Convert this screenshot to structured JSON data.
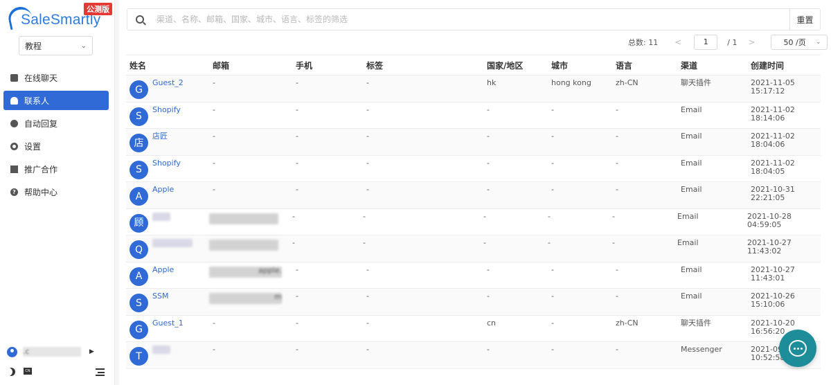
{
  "brand": {
    "name": "SaleSmartly",
    "badge": "公测版",
    "accent": "#2f6ad6"
  },
  "workspace": {
    "selected": "教程"
  },
  "nav": [
    {
      "label": "在线聊天",
      "icon": "chat-icon"
    },
    {
      "label": "联系人",
      "icon": "contacts-icon",
      "active": true
    },
    {
      "label": "自动回复",
      "icon": "bot-icon"
    },
    {
      "label": "设置",
      "icon": "gear-icon"
    },
    {
      "label": "推广合作",
      "icon": "share-icon"
    },
    {
      "label": "帮助中心",
      "icon": "help-icon"
    }
  ],
  "user": {
    "name": ".c"
  },
  "footer": {
    "lang": "CN"
  },
  "search": {
    "placeholder": "渠道、名称、邮箱、国家、城市、语言、标签的筛选",
    "value": "",
    "reset_label": "重置"
  },
  "pagination": {
    "total_label": "总数: 11",
    "prev": "<",
    "next": ">",
    "current": "1",
    "pages": "/ 1",
    "size": "50 /页"
  },
  "table": {
    "headers": [
      "姓名",
      "邮箱",
      "手机",
      "标签",
      "国家/地区",
      "城市",
      "语言",
      "渠道",
      "创建时间"
    ],
    "rows": [
      {
        "initial": "G",
        "name": "Guest_2",
        "email": "-",
        "phone": "-",
        "tag": "-",
        "country": "hk",
        "city": "hong kong",
        "lang": "zh-CN",
        "channel": "聊天插件",
        "created": "2021-11-05\n15:17:12"
      },
      {
        "initial": "S",
        "name": "Shopify",
        "email": "-",
        "phone": "-",
        "tag": "-",
        "country": "-",
        "city": "-",
        "lang": "-",
        "channel": "Email",
        "created": "2021-11-02\n18:14:06"
      },
      {
        "initial": "店",
        "name": "店匠",
        "email": "-",
        "phone": "-",
        "tag": "-",
        "country": "-",
        "city": "-",
        "lang": "-",
        "channel": "Email",
        "created": "2021-11-02\n18:04:06"
      },
      {
        "initial": "S",
        "name": "Shopify",
        "email": "-",
        "phone": "-",
        "tag": "-",
        "country": "-",
        "city": "-",
        "lang": "-",
        "channel": "Email",
        "created": "2021-11-02\n18:04:05"
      },
      {
        "initial": "A",
        "name": "Apple",
        "email": "-",
        "phone": "-",
        "tag": "-",
        "country": "-",
        "city": "-",
        "lang": "-",
        "channel": "Email",
        "created": "2021-10-31\n22:21:05"
      },
      {
        "initial": "顾",
        "name": "",
        "email": "",
        "phone": "-",
        "tag": "-",
        "country": "-",
        "city": "-",
        "lang": "-",
        "channel": "Email",
        "created": "2021-10-28\n04:59:05"
      },
      {
        "initial": "Q",
        "name": "",
        "email": "",
        "phone": "-",
        "tag": "-",
        "country": "-",
        "city": "-",
        "lang": "-",
        "channel": "Email",
        "created": "2021-10-27\n11:43:02"
      },
      {
        "initial": "A",
        "name": "Apple",
        "email": "apple.",
        "phone": "-",
        "tag": "-",
        "country": "-",
        "city": "-",
        "lang": "-",
        "channel": "Email",
        "created": "2021-10-27\n11:43:01"
      },
      {
        "initial": "S",
        "name": "SSM",
        "email": "m",
        "phone": "-",
        "tag": "-",
        "country": "-",
        "city": "-",
        "lang": "-",
        "channel": "Email",
        "created": "2021-10-26\n15:10:06"
      },
      {
        "initial": "G",
        "name": "Guest_1",
        "email": "-",
        "phone": "-",
        "tag": "-",
        "country": "cn",
        "city": "-",
        "lang": "zh-CN",
        "channel": "聊天插件",
        "created": "2021-10-20\n16:56:20"
      },
      {
        "initial": "T",
        "name": "",
        "email": "-",
        "phone": "-",
        "tag": "-",
        "country": "-",
        "city": "-",
        "lang": "-",
        "channel": "Messenger",
        "created": "2021-09\n10:52:58"
      }
    ]
  },
  "chat_widget": {
    "icon": "chat-bubble-icon",
    "color": "#1d8d99"
  }
}
